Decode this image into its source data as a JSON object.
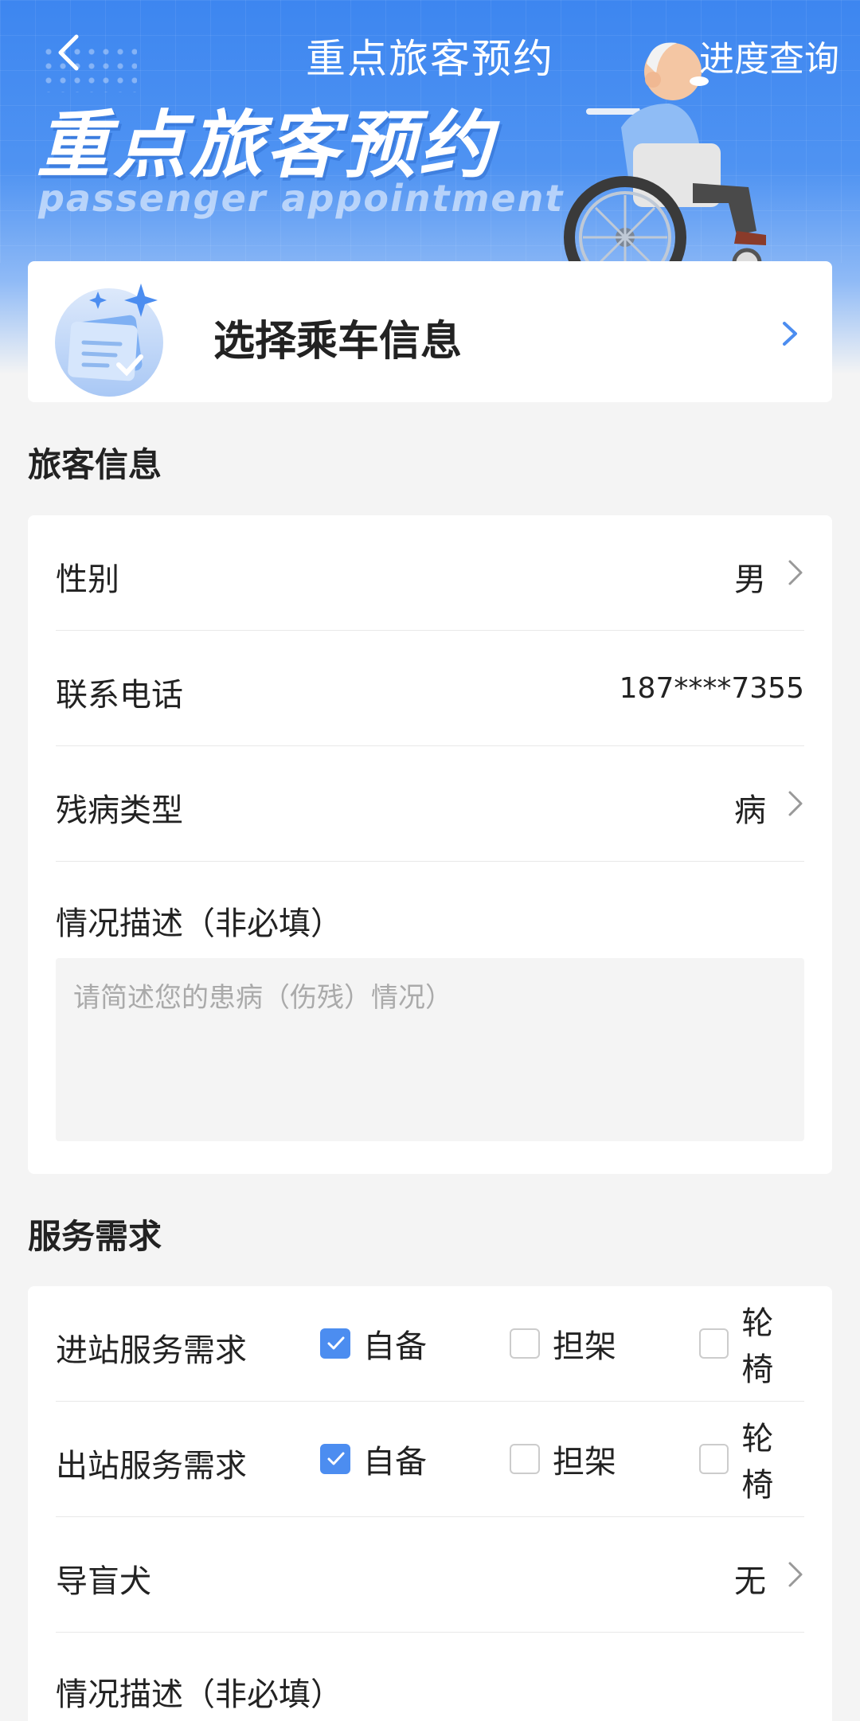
{
  "header": {
    "title": "重点旅客预约",
    "progress_link": "进度查询",
    "banner_title": "重点旅客预约",
    "banner_subtitle": "passenger appointment"
  },
  "select_trip": {
    "label": "选择乘车信息"
  },
  "passenger_section": {
    "title": "旅客信息",
    "gender": {
      "label": "性别",
      "value": "男"
    },
    "phone": {
      "label": "联系电话",
      "value": "187****7355"
    },
    "disability_type": {
      "label": "残病类型",
      "value": "病"
    },
    "description": {
      "label": "情况描述（非必填）",
      "placeholder": "请简述您的患病（伤残）情况）"
    }
  },
  "service_section": {
    "title": "服务需求",
    "entry": {
      "label": "进站服务需求",
      "options": [
        {
          "label": "自备",
          "checked": true
        },
        {
          "label": "担架",
          "checked": false
        },
        {
          "label": "轮椅",
          "checked": false
        }
      ]
    },
    "exit": {
      "label": "出站服务需求",
      "options": [
        {
          "label": "自备",
          "checked": true
        },
        {
          "label": "担架",
          "checked": false
        },
        {
          "label": "轮椅",
          "checked": false
        }
      ]
    },
    "guide_dog": {
      "label": "导盲犬",
      "value": "无"
    },
    "description": {
      "label": "情况描述（非必填）"
    }
  },
  "colors": {
    "accent": "#4c8df0",
    "hero_top": "#3d86f0",
    "background": "#f4f4f4"
  }
}
